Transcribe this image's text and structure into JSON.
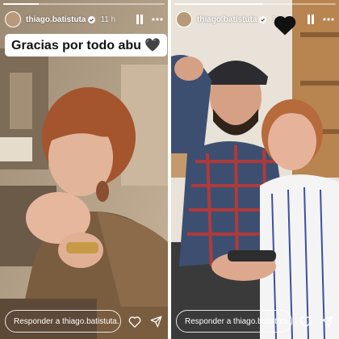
{
  "stories": [
    {
      "username": "thiago.batistuta",
      "time": "11 h",
      "progress": 0.22,
      "caption": "Gracias por todo abu 🖤",
      "reply_placeholder": "Responder a thiago.batistuta..."
    },
    {
      "username": "thiago.batistuta",
      "time": "11 h",
      "progress": 0.55,
      "reply_placeholder": "Responder a thiago.batistuta..."
    }
  ],
  "colors": {
    "progress_track": "#9a9a9a",
    "progress_fill": "#ffffff",
    "caption_bg": "#ffffff"
  }
}
